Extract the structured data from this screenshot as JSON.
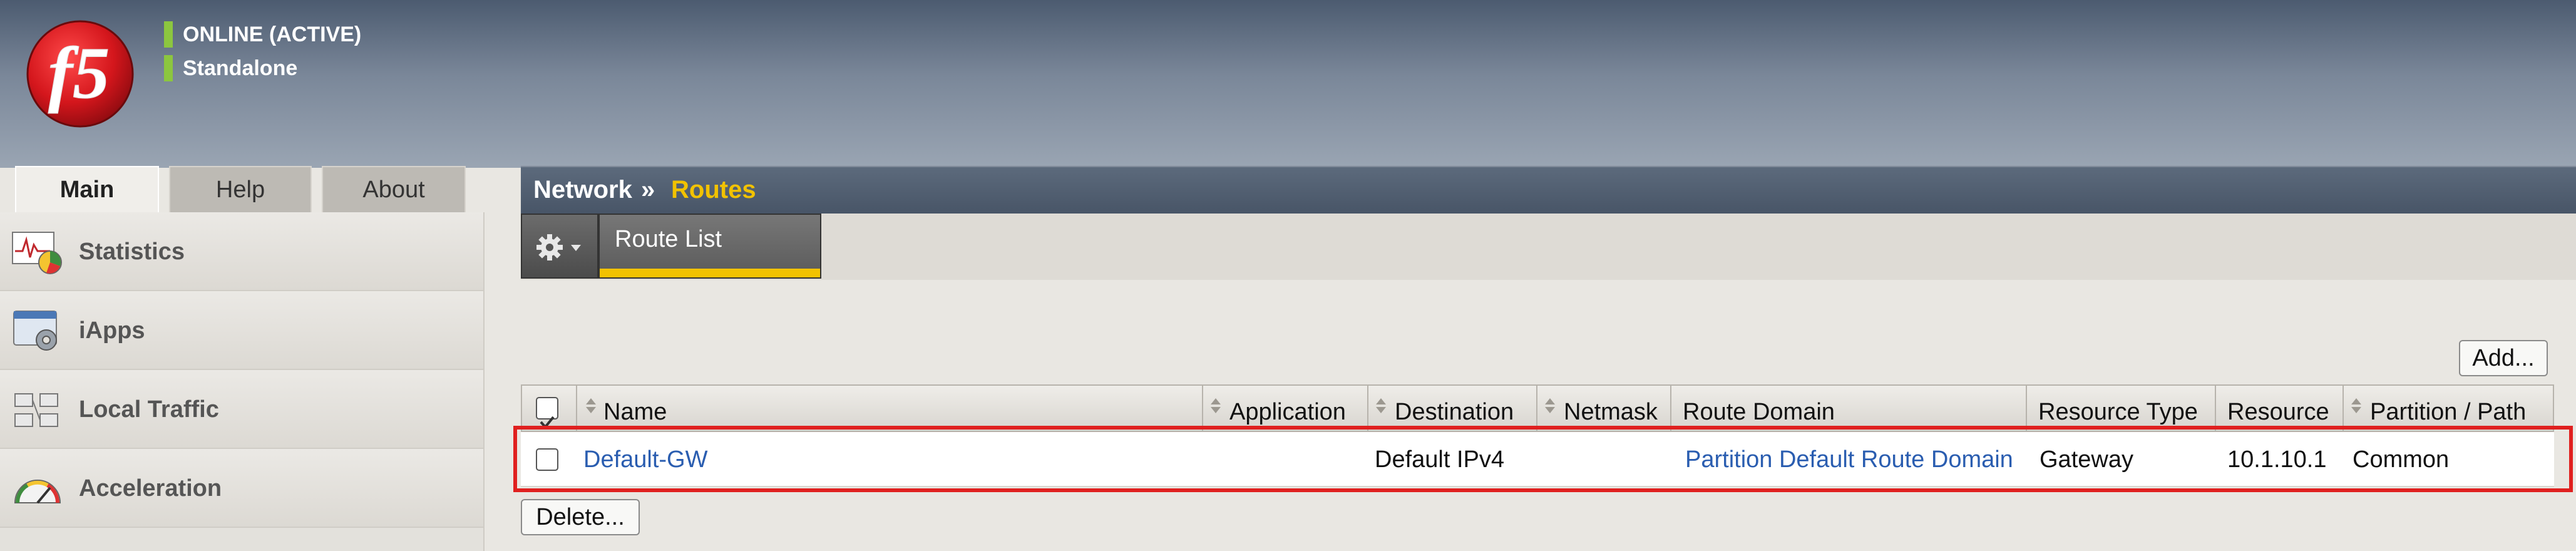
{
  "header": {
    "status_primary": "ONLINE (ACTIVE)",
    "status_secondary": "Standalone",
    "status_color": "#8cc63f",
    "logo_text": "f5"
  },
  "tabs": [
    {
      "label": "Main",
      "active": true
    },
    {
      "label": "Help",
      "active": false
    },
    {
      "label": "About",
      "active": false
    }
  ],
  "breadcrumb": {
    "section": "Network",
    "separator": "»",
    "current": "Routes",
    "current_color": "#f2c200"
  },
  "sidebar": {
    "items": [
      {
        "label": "Statistics",
        "icon": "statistics-icon"
      },
      {
        "label": "iApps",
        "icon": "iapps-icon"
      },
      {
        "label": "Local Traffic",
        "icon": "local-traffic-icon"
      },
      {
        "label": "Acceleration",
        "icon": "acceleration-icon"
      }
    ]
  },
  "toolbar": {
    "menu_icon": "gear-icon",
    "active_tab": "Route List"
  },
  "buttons": {
    "add": "Add...",
    "delete": "Delete..."
  },
  "table": {
    "columns": [
      "Name",
      "Application",
      "Destination",
      "Netmask",
      "Route Domain",
      "Resource Type",
      "Resource",
      "Partition / Path"
    ],
    "rows": [
      {
        "name": "Default-GW",
        "application": "",
        "destination": "Default IPv4",
        "netmask": "",
        "route_domain": "Partition Default Route Domain",
        "resource_type": "Gateway",
        "resource": "10.1.10.1",
        "partition": "Common"
      }
    ]
  },
  "colors": {
    "link": "#2a5db0",
    "highlight": "#e0201f"
  }
}
